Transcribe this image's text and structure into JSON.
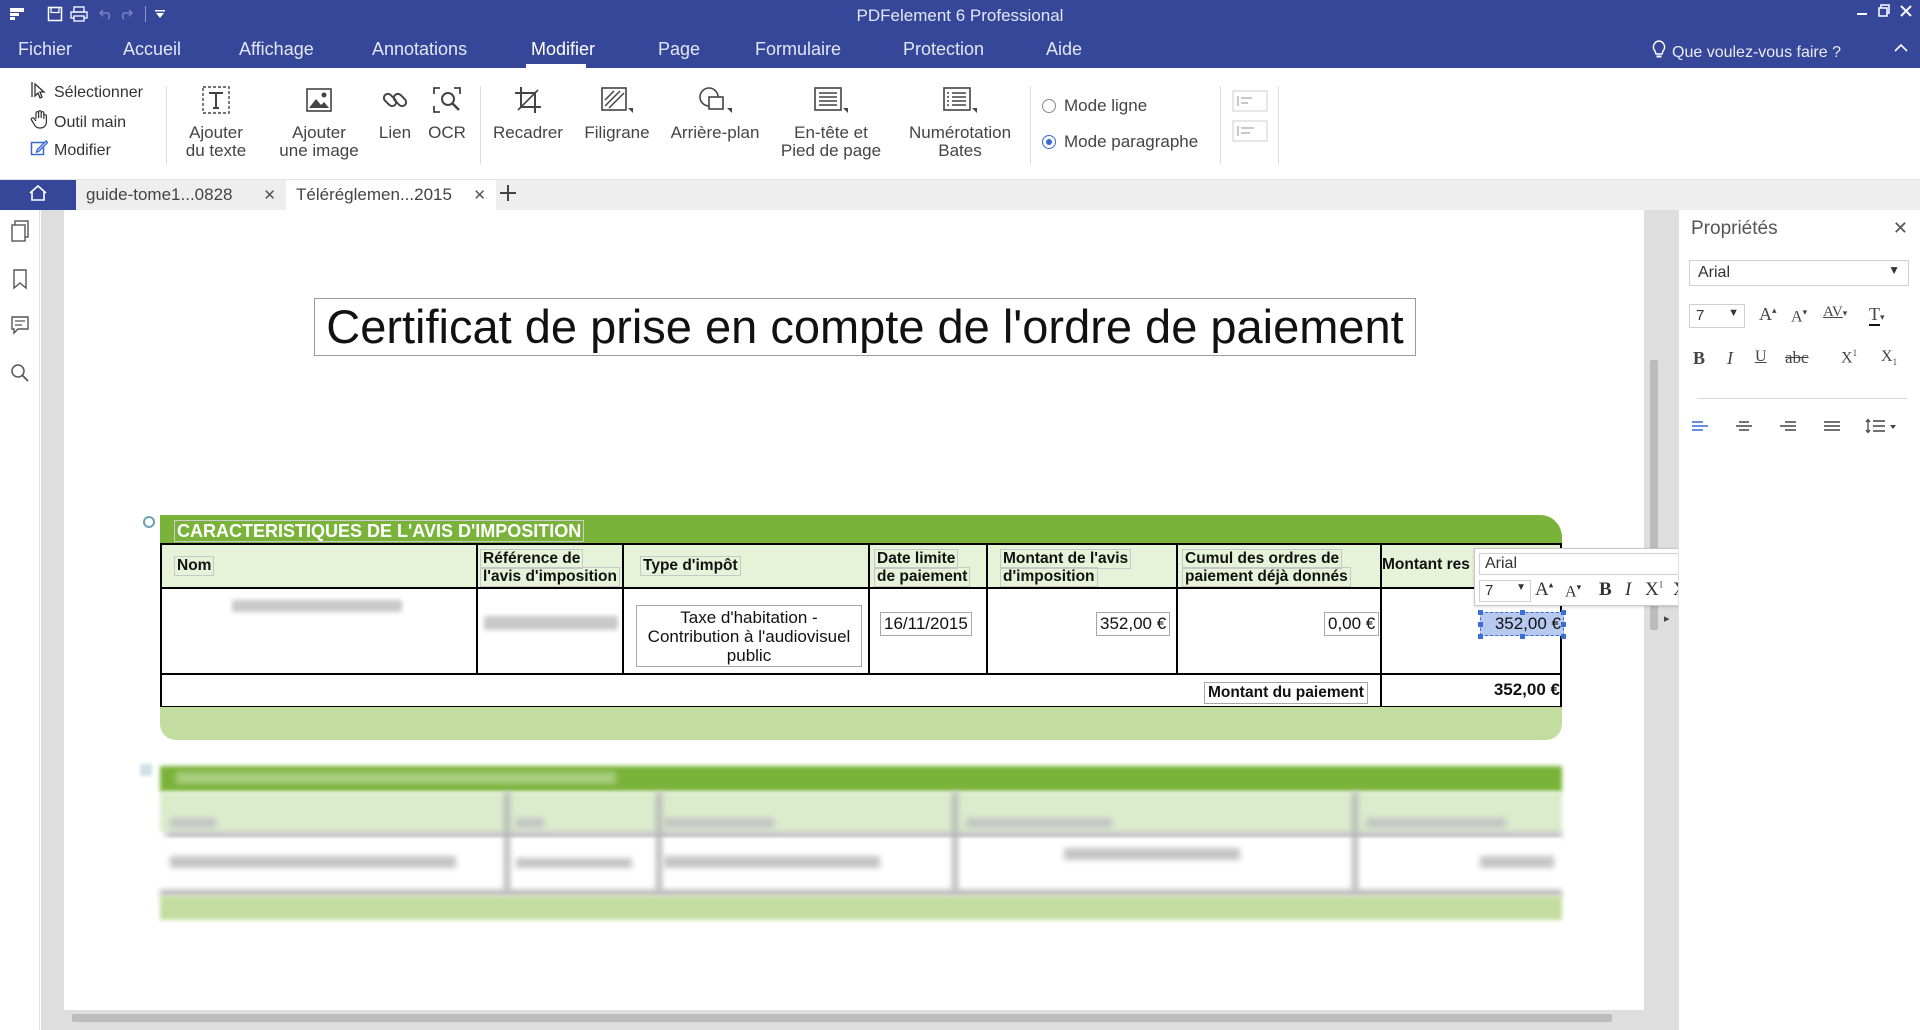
{
  "app": {
    "title": "PDFelement 6 Professional"
  },
  "menu": {
    "items": [
      "Fichier",
      "Accueil",
      "Affichage",
      "Annotations",
      "Modifier",
      "Page",
      "Formulaire",
      "Protection",
      "Aide"
    ],
    "help_search": "Que voulez-vous faire ?"
  },
  "ribbon": {
    "select": "Sélectionner",
    "hand": "Outil main",
    "edit": "Modifier",
    "add_text_1": "Ajouter",
    "add_text_2": "du texte",
    "add_image_1": "Ajouter",
    "add_image_2": "une image",
    "link": "Lien",
    "ocr": "OCR",
    "crop": "Recadrer",
    "watermark": "Filigrane",
    "background": "Arrière-plan",
    "header_1": "En-tête et",
    "header_2": "Pied de page",
    "bates_1": "Numérotation",
    "bates_2": "Bates",
    "line_mode": "Mode ligne",
    "paragraph_mode": "Mode paragraphe"
  },
  "tabs": [
    {
      "label": "guide-tome1...0828"
    },
    {
      "label": "Téléréglemen...2015"
    }
  ],
  "properties": {
    "title": "Propriétés",
    "font": "Arial",
    "size": "7"
  },
  "document": {
    "title": "Certificat de prise en compte de l'ordre de paiement",
    "section_header": "CARACTERISTIQUES DE L'AVIS D'IMPOSITION",
    "columns": {
      "nom": "Nom",
      "ref_1": "Référence de",
      "ref_2": "l'avis d'imposition",
      "type": "Type d'impôt",
      "date_1": "Date limite",
      "date_2": "de paiement",
      "montant_1": "Montant de l'avis",
      "montant_2": "d'imposition",
      "cumul_1": "Cumul des ordres de",
      "cumul_2": "paiement déjà donnés",
      "restant": "Montant res"
    },
    "row": {
      "type_1": "Taxe d'habitation -",
      "type_2": "Contribution à l'audiovisuel",
      "type_3": "public",
      "date": "16/11/2015",
      "montant": "352,00 €",
      "cumul": "0,00 €",
      "restant": "352,00 €"
    },
    "payment_label": "Montant du paiement",
    "payment_value": "352,00 €"
  },
  "float_toolbar": {
    "font": "Arial",
    "size": "7"
  },
  "colors": {
    "brand": "#36479a",
    "green": "#7ab33a",
    "light_green": "#e7f3d9",
    "selection": "#3d6ed6"
  }
}
